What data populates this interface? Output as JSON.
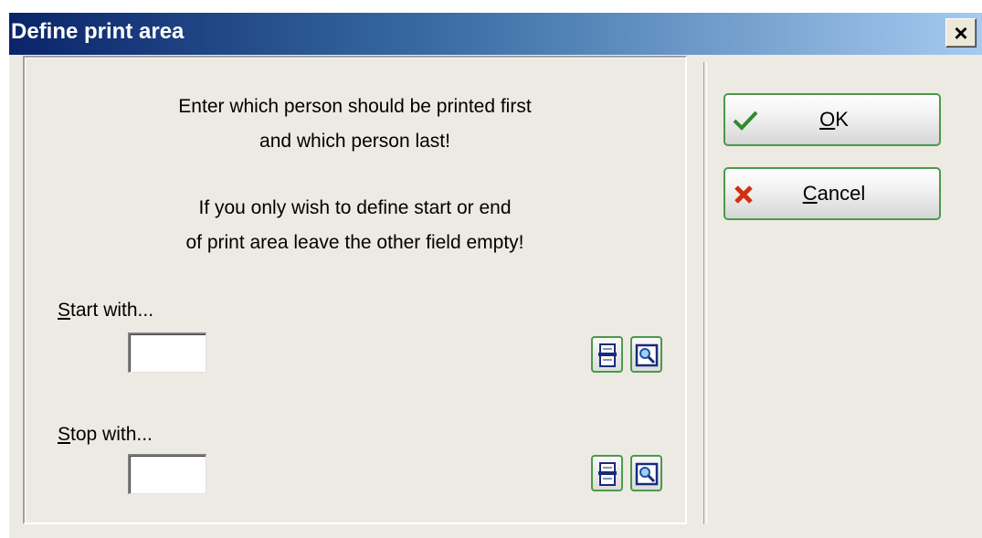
{
  "window": {
    "title": "Define print area",
    "close_glyph": "✕"
  },
  "message": {
    "line1": "Enter which person should be printed first",
    "line2": "and which person last!",
    "line3": "If you only wish to define start or end",
    "line4": "of print area leave the other field empty!"
  },
  "start": {
    "label_mnemonic": "S",
    "label_rest": "tart with...",
    "value": ""
  },
  "stop": {
    "label_mnemonic": "S",
    "label_rest": "top with...",
    "value": ""
  },
  "buttons": {
    "ok_mnemonic": "O",
    "ok_rest": "K",
    "cancel_mnemonic": "C",
    "cancel_rest": "ancel"
  },
  "icons": {
    "ok": "check-icon",
    "cancel": "x-icon",
    "list": "list-picker-icon",
    "search": "search-icon"
  },
  "colors": {
    "title_gradient_start": "#0a246a",
    "title_gradient_end": "#a6caf0",
    "button_border": "#4a9a4a",
    "check": "#2e8b2e",
    "cross": "#d03010"
  }
}
